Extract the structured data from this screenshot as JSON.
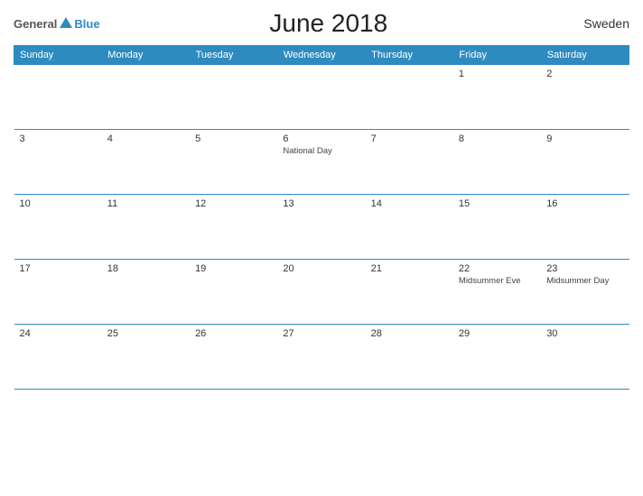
{
  "logo": {
    "general": "General",
    "blue": "Blue"
  },
  "header": {
    "title": "June 2018",
    "country": "Sweden"
  },
  "days_of_week": [
    "Sunday",
    "Monday",
    "Tuesday",
    "Wednesday",
    "Thursday",
    "Friday",
    "Saturday"
  ],
  "weeks": [
    [
      {
        "day": "",
        "event": ""
      },
      {
        "day": "",
        "event": ""
      },
      {
        "day": "",
        "event": ""
      },
      {
        "day": "",
        "event": ""
      },
      {
        "day": "",
        "event": ""
      },
      {
        "day": "1",
        "event": ""
      },
      {
        "day": "2",
        "event": ""
      }
    ],
    [
      {
        "day": "3",
        "event": ""
      },
      {
        "day": "4",
        "event": ""
      },
      {
        "day": "5",
        "event": ""
      },
      {
        "day": "6",
        "event": "National Day"
      },
      {
        "day": "7",
        "event": ""
      },
      {
        "day": "8",
        "event": ""
      },
      {
        "day": "9",
        "event": ""
      }
    ],
    [
      {
        "day": "10",
        "event": ""
      },
      {
        "day": "11",
        "event": ""
      },
      {
        "day": "12",
        "event": ""
      },
      {
        "day": "13",
        "event": ""
      },
      {
        "day": "14",
        "event": ""
      },
      {
        "day": "15",
        "event": ""
      },
      {
        "day": "16",
        "event": ""
      }
    ],
    [
      {
        "day": "17",
        "event": ""
      },
      {
        "day": "18",
        "event": ""
      },
      {
        "day": "19",
        "event": ""
      },
      {
        "day": "20",
        "event": ""
      },
      {
        "day": "21",
        "event": ""
      },
      {
        "day": "22",
        "event": "Midsummer Eve"
      },
      {
        "day": "23",
        "event": "Midsummer Day"
      }
    ],
    [
      {
        "day": "24",
        "event": ""
      },
      {
        "day": "25",
        "event": ""
      },
      {
        "day": "26",
        "event": ""
      },
      {
        "day": "27",
        "event": ""
      },
      {
        "day": "28",
        "event": ""
      },
      {
        "day": "29",
        "event": ""
      },
      {
        "day": "30",
        "event": ""
      }
    ]
  ]
}
